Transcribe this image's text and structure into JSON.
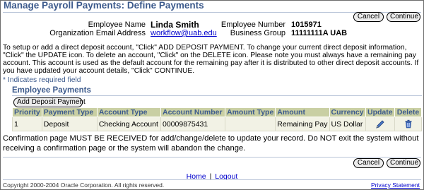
{
  "page": {
    "title": "Manage Payroll Payments: Define Payments"
  },
  "buttons": {
    "cancel": "Cancel",
    "continue": "Continue",
    "add_deposit": "Add Deposit Payment"
  },
  "employee": {
    "name_label": "Employee Name",
    "name_value": "Linda Smith",
    "email_label": "Organization Email Address",
    "email_value": "workflow@uab.edu",
    "number_label": "Employee Number",
    "number_value": "1015971",
    "group_label": "Business Group",
    "group_value": "11111111A UAB"
  },
  "instructions": "To setup or add a direct deposit account, \"Click\" ADD DEPOSIT PAYMENT. To change your current direct deposit information, \"Click\" the UPDATE icon. To delete an account, \"Click\" on the DELETE icon. Please note you must always have a remaining pay account. This account is used as the default account for the remaining pay after it is distributed to other direct deposit accounts. If you have updated your account details, \"Click\" CONTINUE.",
  "required_note": "Indicates required field",
  "required_star": "*",
  "section": {
    "title": "Employee Payments"
  },
  "table": {
    "headers": [
      "Priority",
      "Payment Type",
      "Account Type",
      "Account Number",
      "Amount Type",
      "Amount",
      "Currency",
      "Update",
      "Delete"
    ],
    "rows": [
      {
        "priority": "1",
        "payment_type": "Deposit",
        "account_type": "Checking Account",
        "account_number": "00009875431",
        "amount_type": "",
        "amount": "Remaining Pay",
        "currency": "US Dollar"
      }
    ]
  },
  "confirmation": "Confirmation page MUST BE RECEIVED for add/change/delete to update your record. Do NOT exit the system without receiving a confirmation page or the system will abandon the change.",
  "footer": {
    "home": "Home",
    "separator": "|",
    "logout": "Logout",
    "copyright": "Copyright 2000-2004 Oracle Corporation. All rights reserved.",
    "privacy": "Privacy Statement"
  },
  "icons": {
    "update": "pencil-icon",
    "delete": "trash-icon"
  },
  "colors": {
    "title": "#3c5a8c",
    "table_header_bg": "#c9cfa3",
    "table_row_bg": "#f2f2e5",
    "link": "#0000cc"
  }
}
